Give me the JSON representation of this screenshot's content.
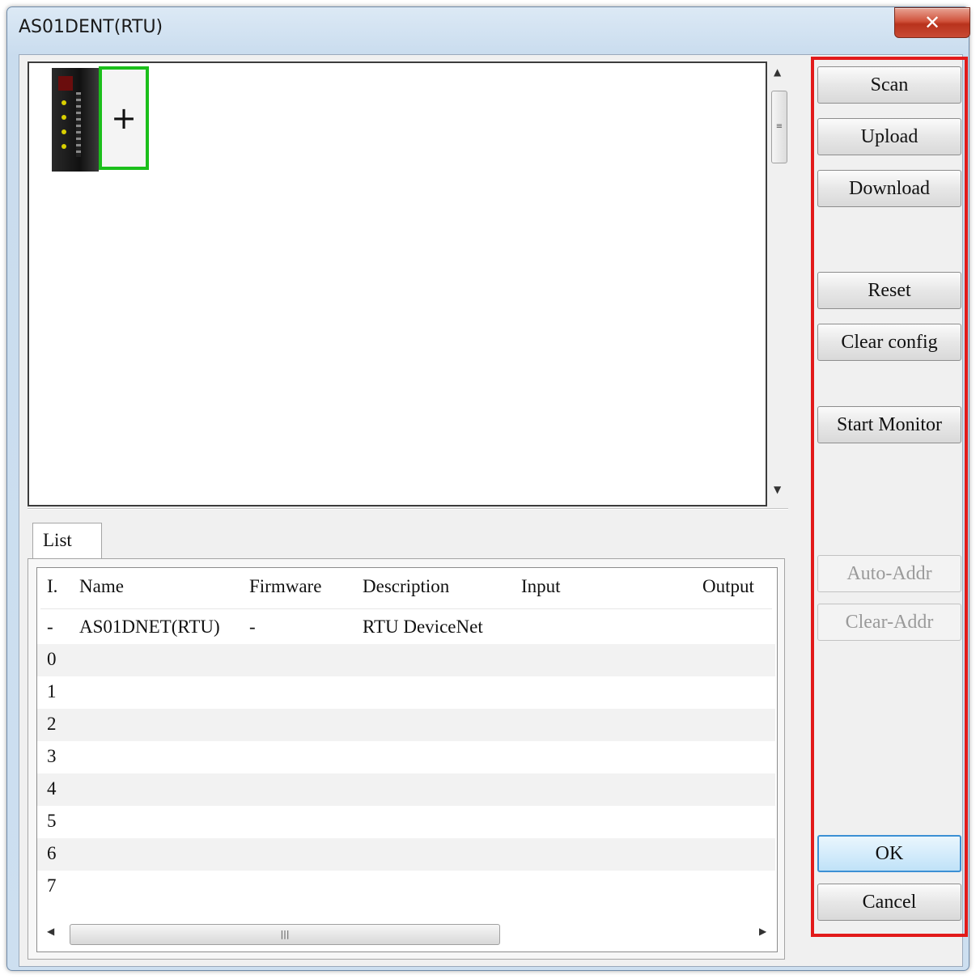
{
  "window": {
    "title": "AS01DENT(RTU)",
    "close_symbol": "✕"
  },
  "canvas": {
    "add_symbol": "+"
  },
  "tabs": [
    {
      "label": "List"
    }
  ],
  "table": {
    "columns": [
      "I.",
      "Name",
      "Firmware",
      "Description",
      "Input",
      "Output"
    ],
    "rows": [
      {
        "index": "-",
        "name": "AS01DNET(RTU)",
        "firmware": "-",
        "description": "RTU DeviceNet",
        "input": "",
        "output": ""
      },
      {
        "index": "0",
        "name": "",
        "firmware": "",
        "description": "",
        "input": "",
        "output": ""
      },
      {
        "index": "1",
        "name": "",
        "firmware": "",
        "description": "",
        "input": "",
        "output": ""
      },
      {
        "index": "2",
        "name": "",
        "firmware": "",
        "description": "",
        "input": "",
        "output": ""
      },
      {
        "index": "3",
        "name": "",
        "firmware": "",
        "description": "",
        "input": "",
        "output": ""
      },
      {
        "index": "4",
        "name": "",
        "firmware": "",
        "description": "",
        "input": "",
        "output": ""
      },
      {
        "index": "5",
        "name": "",
        "firmware": "",
        "description": "",
        "input": "",
        "output": ""
      },
      {
        "index": "6",
        "name": "",
        "firmware": "",
        "description": "",
        "input": "",
        "output": ""
      },
      {
        "index": "7",
        "name": "",
        "firmware": "",
        "description": "",
        "input": "",
        "output": ""
      }
    ]
  },
  "buttons": {
    "scan": "Scan",
    "upload": "Upload",
    "download": "Download",
    "reset": "Reset",
    "clear_config": "Clear config",
    "start_monitor": "Start Monitor",
    "auto_addr": "Auto-Addr",
    "clear_addr": "Clear-Addr",
    "ok": "OK",
    "cancel": "Cancel"
  },
  "colors": {
    "highlight_border": "#e21a1a",
    "selected_slot": "#1bbf1b"
  }
}
